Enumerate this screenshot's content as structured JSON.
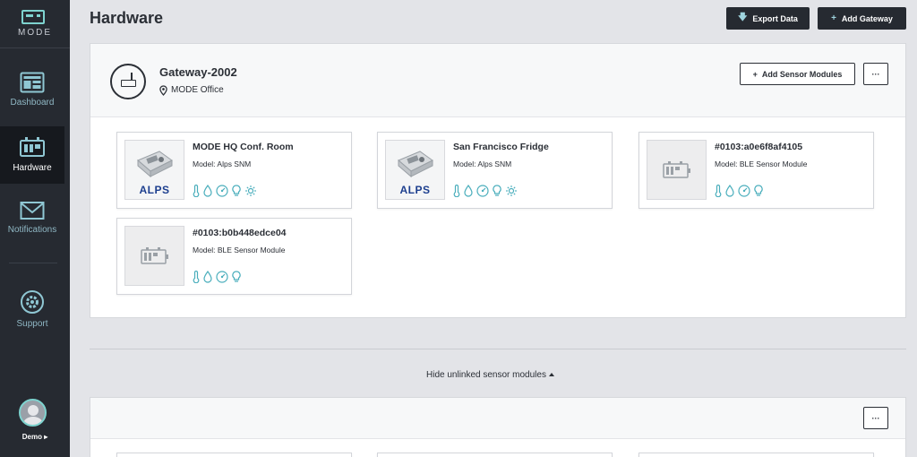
{
  "app": {
    "logo_text": "MODE"
  },
  "sidebar": {
    "items": [
      {
        "label": "Dashboard",
        "icon": "dashboard-icon"
      },
      {
        "label": "Hardware",
        "icon": "hardware-icon",
        "active": true
      },
      {
        "label": "Notifications",
        "icon": "envelope-icon"
      },
      {
        "label": "Support",
        "icon": "gear-icon"
      }
    ],
    "user": {
      "name": "Demo ▸"
    }
  },
  "header": {
    "title": "Hardware",
    "export_label": "Export Data",
    "add_gateway_label": "Add Gateway"
  },
  "gateway": {
    "name": "Gateway-2002",
    "location": "MODE Office",
    "add_sensor_label": "Add Sensor Modules",
    "more_label": "···"
  },
  "sensors": [
    {
      "title": "MODE HQ Conf. Room",
      "model": "Model: Alps SNM",
      "thumb": "alps",
      "brand": "ALPS",
      "icons": [
        "thermometer-icon",
        "humidity-icon",
        "pressure-icon",
        "light-bulb-icon",
        "sun-icon"
      ]
    },
    {
      "title": "San Francisco Fridge",
      "model": "Model: Alps SNM",
      "thumb": "alps",
      "brand": "ALPS",
      "icons": [
        "thermometer-icon",
        "humidity-icon",
        "pressure-icon",
        "light-bulb-icon",
        "sun-icon"
      ]
    },
    {
      "title": "#0103:a0e6f8af4105",
      "model": "Model: BLE Sensor Module",
      "thumb": "ble",
      "icons": [
        "thermometer-icon",
        "humidity-icon",
        "pressure-icon",
        "light-bulb-icon"
      ]
    },
    {
      "title": "#0103:b0b448edce04",
      "model": "Model: BLE Sensor Module",
      "thumb": "ble",
      "icons": [
        "thermometer-icon",
        "humidity-icon",
        "pressure-icon",
        "light-bulb-icon"
      ]
    }
  ],
  "unlinked": {
    "toggle_label": "Hide unlinked sensor modules",
    "more_label": "···"
  },
  "colors": {
    "sidebar": "#262a31",
    "accent": "#7ed3cf",
    "sensor_icon": "#4aaebc",
    "alps_blue": "#1d3f8f"
  }
}
